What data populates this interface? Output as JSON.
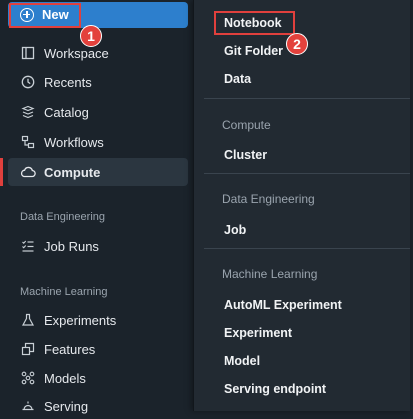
{
  "sidebar": {
    "new_label": "New",
    "items": [
      {
        "label": "Workspace",
        "icon": "workspace-icon"
      },
      {
        "label": "Recents",
        "icon": "clock-icon"
      },
      {
        "label": "Catalog",
        "icon": "catalog-icon"
      },
      {
        "label": "Workflows",
        "icon": "workflows-icon"
      },
      {
        "label": "Compute",
        "icon": "cloud-icon"
      }
    ],
    "data_engineering": {
      "title": "Data Engineering",
      "items": [
        {
          "label": "Job Runs",
          "icon": "job-runs-icon"
        }
      ]
    },
    "machine_learning": {
      "title": "Machine Learning",
      "items": [
        {
          "label": "Experiments",
          "icon": "flask-icon"
        },
        {
          "label": "Features",
          "icon": "features-icon"
        },
        {
          "label": "Models",
          "icon": "models-icon"
        },
        {
          "label": "Serving",
          "icon": "serving-icon"
        }
      ]
    }
  },
  "menu": {
    "top_items": [
      "Notebook",
      "Git Folder",
      "Data"
    ],
    "compute": {
      "title": "Compute",
      "items": [
        "Cluster"
      ]
    },
    "data_engineering": {
      "title": "Data Engineering",
      "items": [
        "Job"
      ]
    },
    "machine_learning": {
      "title": "Machine Learning",
      "items": [
        "AutoML Experiment",
        "Experiment",
        "Model",
        "Serving endpoint"
      ]
    }
  },
  "annotations": {
    "step1": "1",
    "step2": "2"
  },
  "colors": {
    "accent": "#2d7fcd",
    "highlight": "#e0403d",
    "background": "#1b232b"
  }
}
